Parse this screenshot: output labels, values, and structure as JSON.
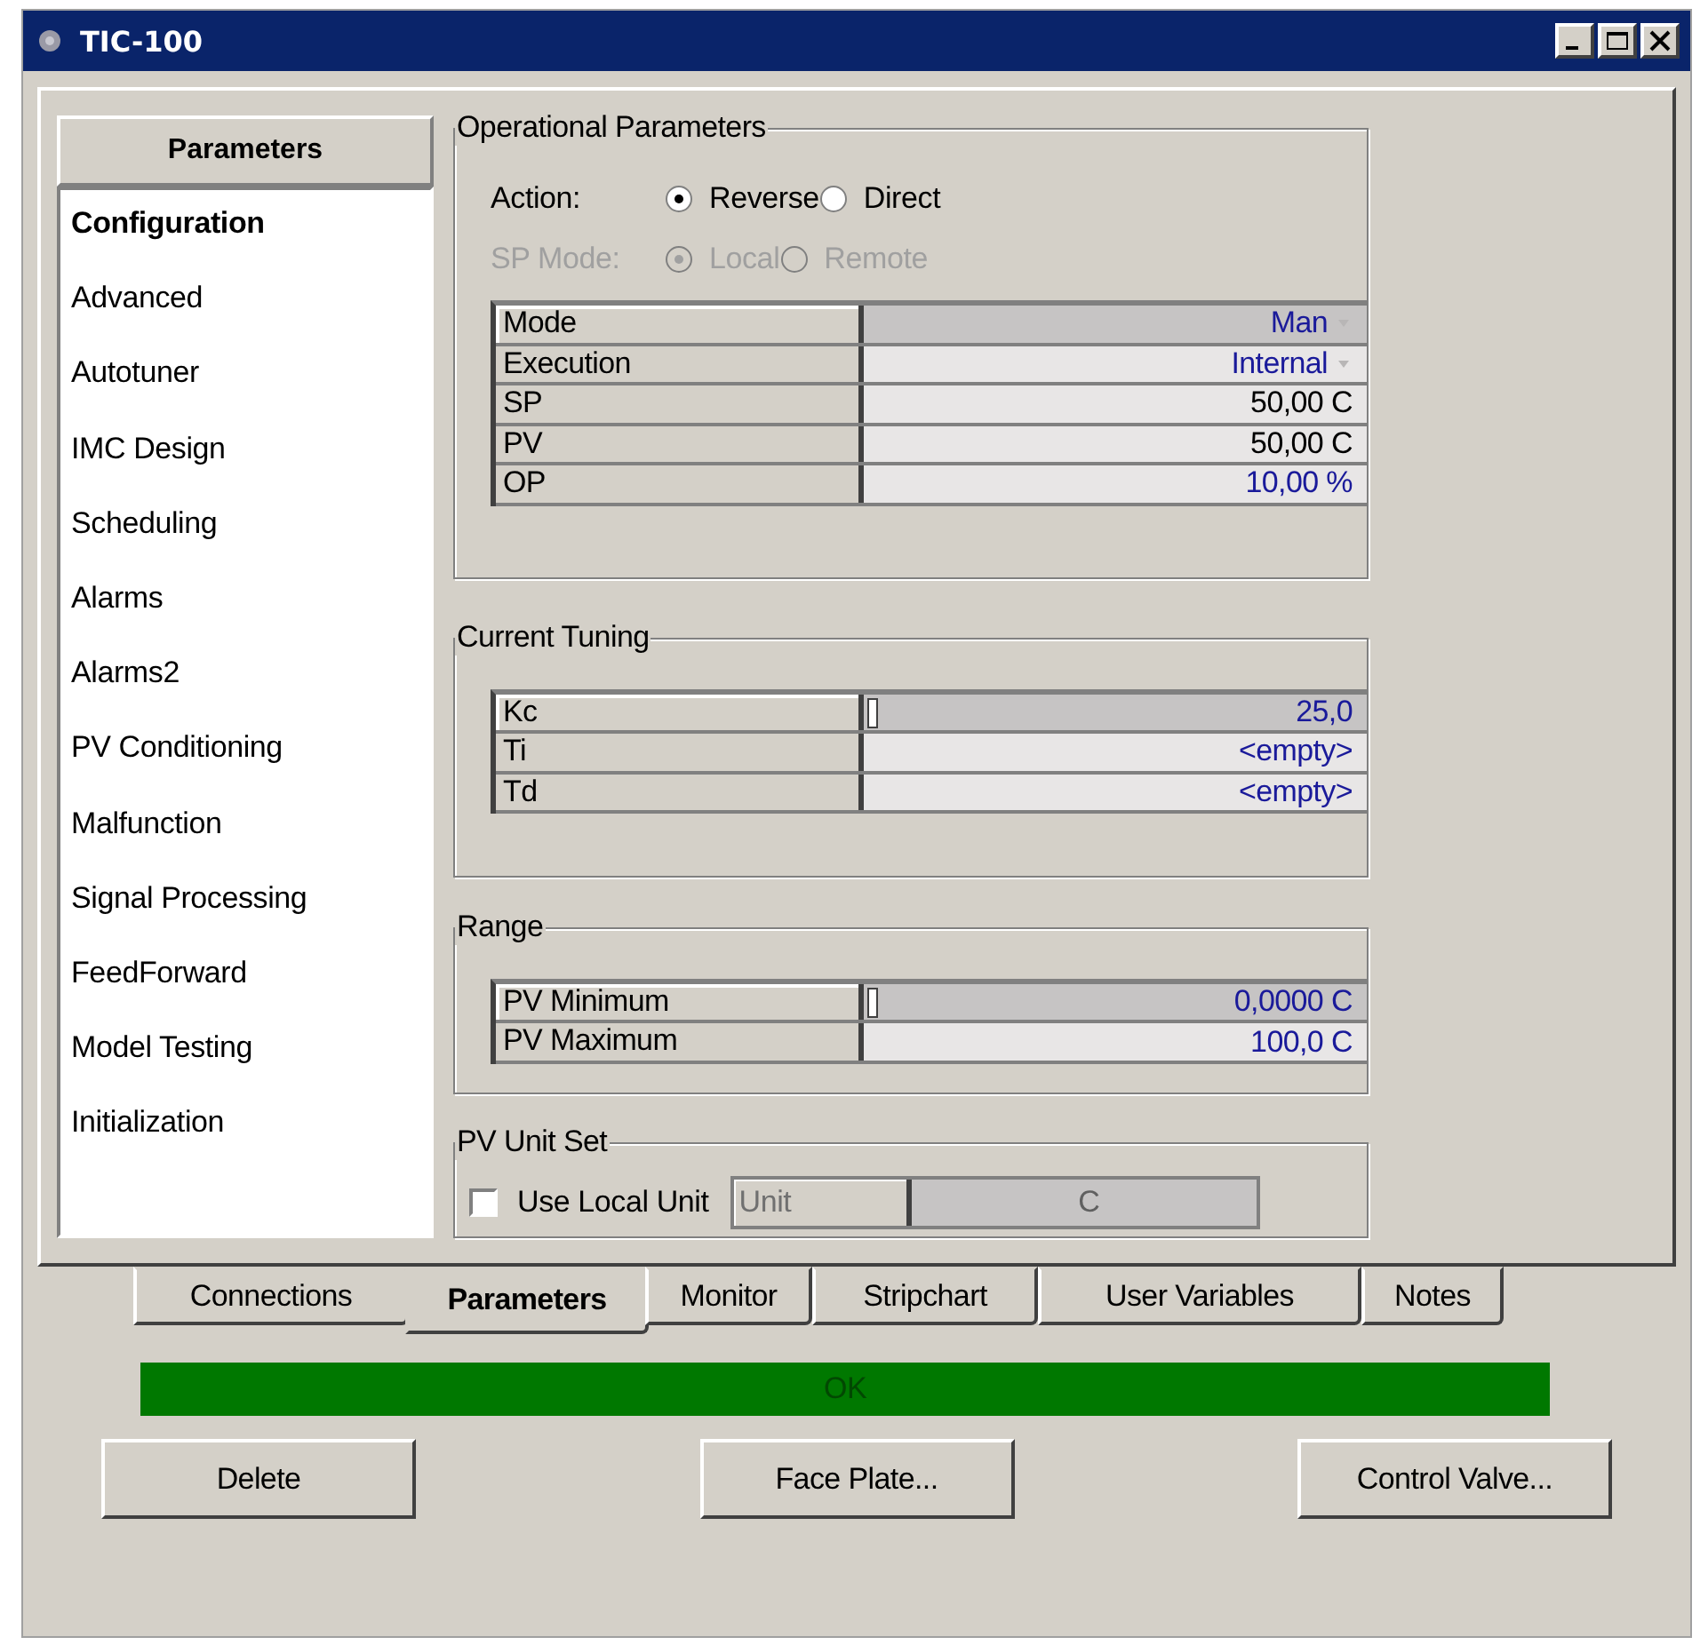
{
  "window": {
    "title": "TIC-100"
  },
  "sidebar": {
    "header": "Parameters",
    "items": [
      {
        "label": "Configuration",
        "selected": true
      },
      {
        "label": "Advanced",
        "selected": false
      },
      {
        "label": "Autotuner",
        "selected": false
      },
      {
        "label": "IMC Design",
        "selected": false
      },
      {
        "label": "Scheduling",
        "selected": false
      },
      {
        "label": "Alarms",
        "selected": false
      },
      {
        "label": "Alarms2",
        "selected": false
      },
      {
        "label": "PV Conditioning",
        "selected": false
      },
      {
        "label": "Malfunction",
        "selected": false
      },
      {
        "label": "Signal Processing",
        "selected": false
      },
      {
        "label": "FeedForward",
        "selected": false
      },
      {
        "label": "Model Testing",
        "selected": false
      },
      {
        "label": "Initialization",
        "selected": false
      }
    ]
  },
  "operational_parameters": {
    "title": "Operational Parameters",
    "radio_rows": [
      {
        "label": "Action:",
        "disabled": false,
        "options": [
          {
            "label": "Reverse",
            "selected": true
          },
          {
            "label": "Direct",
            "selected": false
          }
        ]
      },
      {
        "label": "SP Mode:",
        "disabled": true,
        "options": [
          {
            "label": "Local",
            "selected": true
          },
          {
            "label": "Remote",
            "selected": false
          }
        ]
      }
    ],
    "rows": [
      {
        "name": "Mode",
        "value": "Man",
        "kind": "dropdown",
        "editable": true,
        "selected": true
      },
      {
        "name": "Execution",
        "value": "Internal",
        "kind": "dropdown",
        "editable": true,
        "selected": false
      },
      {
        "name": "SP",
        "value": "50,00 C",
        "kind": "value",
        "editable": false,
        "selected": false
      },
      {
        "name": "PV",
        "value": "50,00 C",
        "kind": "value",
        "editable": false,
        "selected": false
      },
      {
        "name": "OP",
        "value": "10,00 %",
        "kind": "value",
        "editable": true,
        "selected": false
      }
    ]
  },
  "current_tuning": {
    "title": "Current Tuning",
    "rows": [
      {
        "name": "Kc",
        "value": "25,0",
        "editable": true,
        "selected": true
      },
      {
        "name": "Ti",
        "value": "<empty>",
        "editable": true,
        "selected": false
      },
      {
        "name": "Td",
        "value": "<empty>",
        "editable": true,
        "selected": false
      }
    ]
  },
  "range": {
    "title": "Range",
    "rows": [
      {
        "name": "PV Minimum",
        "value": "0,0000 C",
        "editable": true,
        "selected": true
      },
      {
        "name": "PV Maximum",
        "value": "100,0 C",
        "editable": true,
        "selected": false
      }
    ]
  },
  "pv_unit_set": {
    "title": "PV Unit Set",
    "checkbox": {
      "label": "Use Local Unit",
      "checked": false
    },
    "unit": {
      "name": "Unit",
      "value": "C",
      "disabled": true
    }
  },
  "tabs": [
    {
      "label": "Connections",
      "selected": false
    },
    {
      "label": "Parameters",
      "selected": true
    },
    {
      "label": "Monitor",
      "selected": false
    },
    {
      "label": "Stripchart",
      "selected": false
    },
    {
      "label": "User Variables",
      "selected": false
    },
    {
      "label": "Notes",
      "selected": false
    }
  ],
  "status_bar": {
    "text": "OK"
  },
  "buttons": [
    "Delete",
    "Face Plate...",
    "Control Valve..."
  ]
}
